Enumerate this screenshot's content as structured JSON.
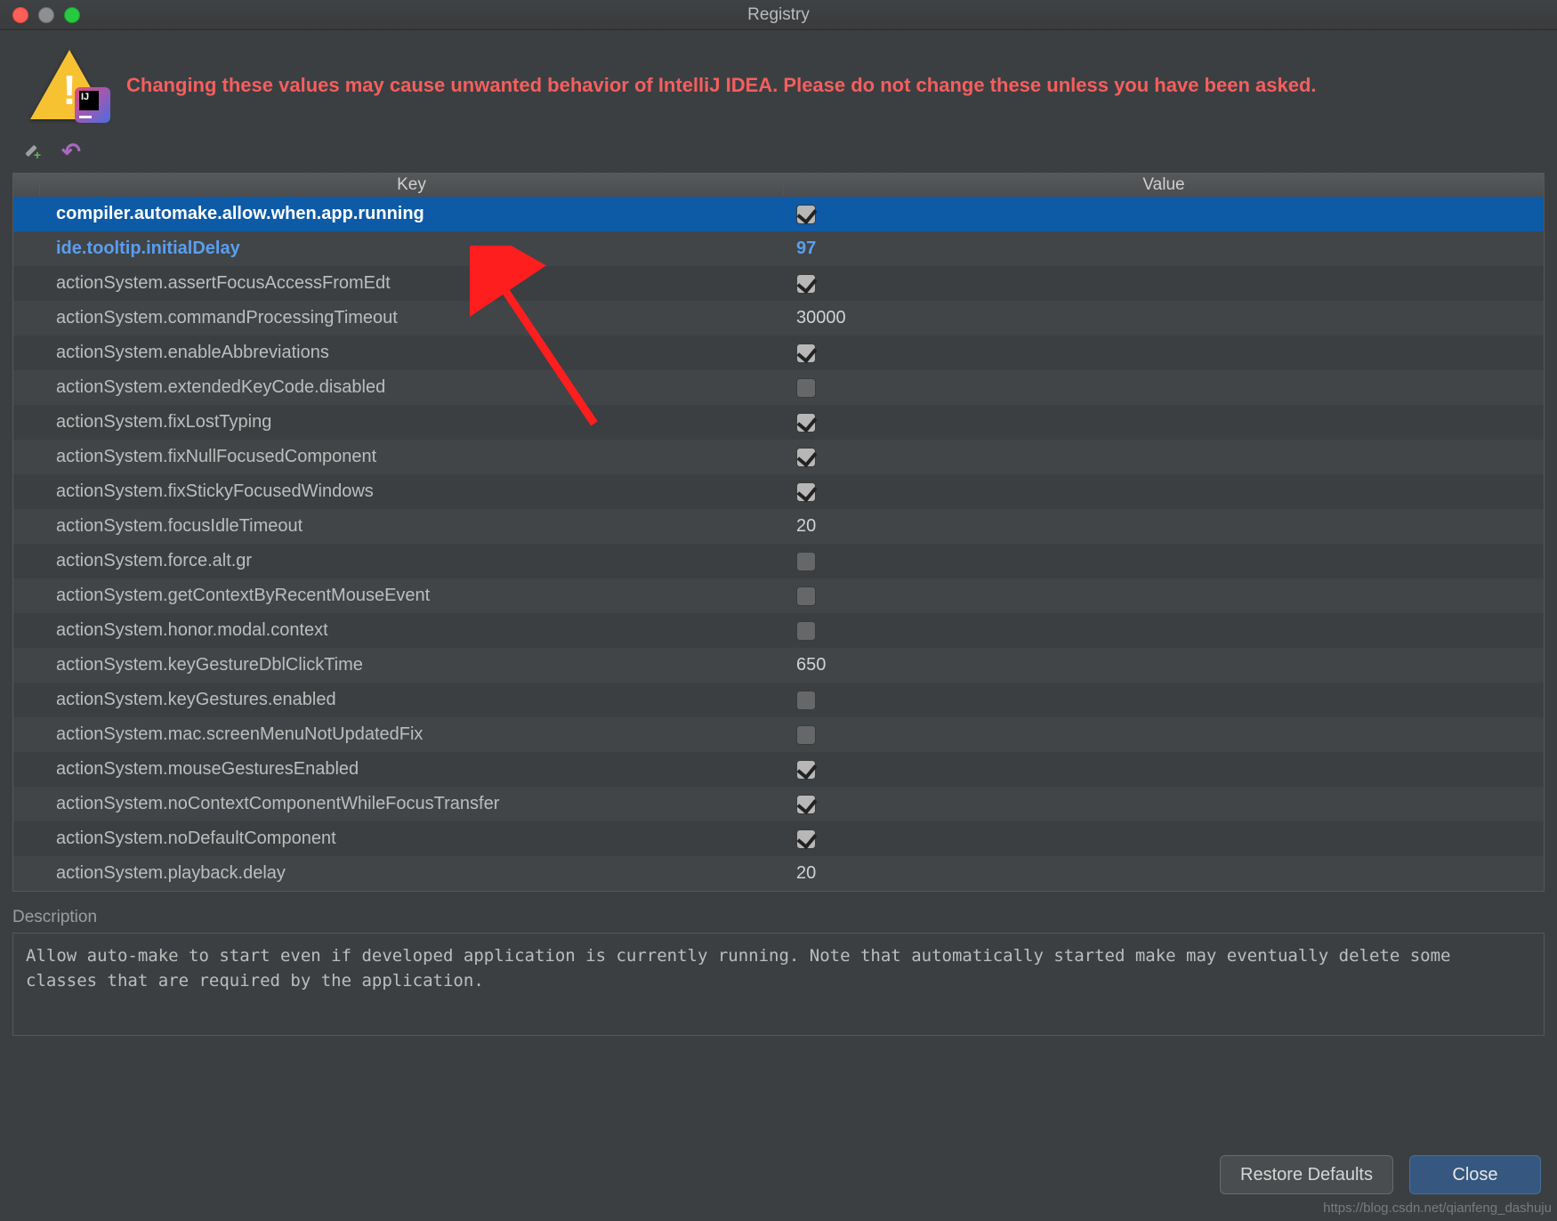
{
  "window": {
    "title": "Registry"
  },
  "banner": {
    "text": "Changing these values may cause unwanted behavior of IntelliJ IDEA. Please do not change these unless you have been asked."
  },
  "columns": {
    "key": "Key",
    "value": "Value"
  },
  "rows": [
    {
      "key": "compiler.automake.allow.when.app.running",
      "type": "check",
      "checked": true,
      "selected": true
    },
    {
      "key": "ide.tooltip.initialDelay",
      "type": "text",
      "value": "97",
      "highlight": true
    },
    {
      "key": "actionSystem.assertFocusAccessFromEdt",
      "type": "check",
      "checked": true
    },
    {
      "key": "actionSystem.commandProcessingTimeout",
      "type": "text",
      "value": "30000"
    },
    {
      "key": "actionSystem.enableAbbreviations",
      "type": "check",
      "checked": true
    },
    {
      "key": "actionSystem.extendedKeyCode.disabled",
      "type": "check",
      "checked": false
    },
    {
      "key": "actionSystem.fixLostTyping",
      "type": "check",
      "checked": true
    },
    {
      "key": "actionSystem.fixNullFocusedComponent",
      "type": "check",
      "checked": true
    },
    {
      "key": "actionSystem.fixStickyFocusedWindows",
      "type": "check",
      "checked": true
    },
    {
      "key": "actionSystem.focusIdleTimeout",
      "type": "text",
      "value": "20"
    },
    {
      "key": "actionSystem.force.alt.gr",
      "type": "check",
      "checked": false
    },
    {
      "key": "actionSystem.getContextByRecentMouseEvent",
      "type": "check",
      "checked": false
    },
    {
      "key": "actionSystem.honor.modal.context",
      "type": "check",
      "checked": false
    },
    {
      "key": "actionSystem.keyGestureDblClickTime",
      "type": "text",
      "value": "650"
    },
    {
      "key": "actionSystem.keyGestures.enabled",
      "type": "check",
      "checked": false
    },
    {
      "key": "actionSystem.mac.screenMenuNotUpdatedFix",
      "type": "check",
      "checked": false
    },
    {
      "key": "actionSystem.mouseGesturesEnabled",
      "type": "check",
      "checked": true
    },
    {
      "key": "actionSystem.noContextComponentWhileFocusTransfer",
      "type": "check",
      "checked": true
    },
    {
      "key": "actionSystem.noDefaultComponent",
      "type": "check",
      "checked": true
    },
    {
      "key": "actionSystem.playback.delay",
      "type": "text",
      "value": "20"
    }
  ],
  "description": {
    "label": "Description",
    "text": "Allow auto-make to start even if developed application is currently running. Note that automatically started make may eventually delete some classes that are required by the application."
  },
  "buttons": {
    "restore": "Restore Defaults",
    "close": "Close"
  },
  "watermark": "https://blog.csdn.net/qianfeng_dashuju"
}
